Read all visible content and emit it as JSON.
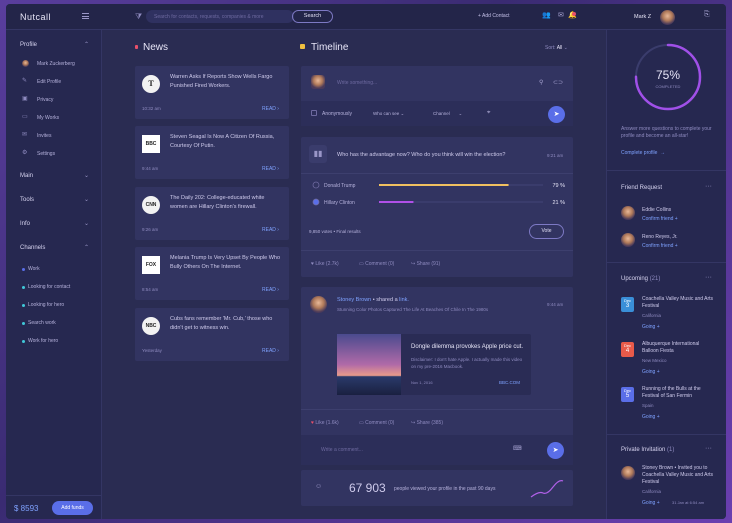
{
  "app": {
    "title": "Nutcall"
  },
  "topbar": {
    "search_placeholder": "Search for contacts, requests, companies & more",
    "search_button": "Search",
    "add_contact": "+ Add Contact",
    "user_name": "Mark Z"
  },
  "sidebar": {
    "profile_label": "Profile",
    "profile_items": [
      {
        "label": "Mark Zuckerberg",
        "icon": "avatar"
      },
      {
        "label": "Edit Profile",
        "icon": "pencil-icon"
      },
      {
        "label": "Privacy",
        "icon": "lock-icon"
      },
      {
        "label": "My Works",
        "icon": "folder-icon"
      },
      {
        "label": "Invites",
        "icon": "mail-icon"
      },
      {
        "label": "Settings",
        "icon": "gear-icon"
      }
    ],
    "main_label": "Main",
    "tools_label": "Tools",
    "info_label": "Info",
    "channels_label": "Channels",
    "channels": [
      {
        "label": "Work",
        "color": "#5a6ee8"
      },
      {
        "label": "Looking for contact",
        "color": "#40c8d8"
      },
      {
        "label": "Looking for hero",
        "color": "#40c8d8"
      },
      {
        "label": "Search work",
        "color": "#40c8d8"
      },
      {
        "label": "Work for hero",
        "color": "#40c8d8"
      }
    ],
    "balance": "$ 8593",
    "add_funds": "Add funds"
  },
  "news": {
    "title": "News",
    "items": [
      {
        "logo": "T",
        "text": "Warren Asks If Reports Show Wells Fargo Punished Fired Workers.",
        "time": "10:32 am",
        "read": "READ"
      },
      {
        "logo": "BBC",
        "text": "Steven Seagal Is Now A Citizen Of Russia, Courtesy Of Putin.",
        "time": "9:44 am",
        "read": "READ"
      },
      {
        "logo": "CNN",
        "text": "The Daily 202: College-educated white women are Hillary Clinton's firewall.",
        "time": "9:26 am",
        "read": "READ"
      },
      {
        "logo": "FOX",
        "text": "Melania Trump Is Very Upset By People Who Bully Others On The Internet.",
        "time": "8:54 am",
        "read": "READ"
      },
      {
        "logo": "NBC",
        "text": "Cubs fans remember 'Mr. Cub,' those who didn't get to witness win.",
        "time": "Yesterday",
        "read": "READ"
      }
    ]
  },
  "timeline": {
    "title": "Timeline",
    "sort_label": "Sort:",
    "sort_value": "All",
    "compose_placeholder": "Write something...",
    "audience": "Anonymously",
    "who_can_see": "Who can see",
    "channel": "Channel"
  },
  "poll": {
    "question": "Who has the advantage now? Who do you think will win the election?",
    "time": "9:21 am",
    "votes_text": "9,850 votes • Final results",
    "vote_button": "Vote",
    "like": "Like (2.7k)",
    "comment": "Comment (0)",
    "share": "Share (91)",
    "chart_data": {
      "type": "bar",
      "categories": [
        "Donald Trump",
        "Hillary Clinton"
      ],
      "values": [
        79,
        21
      ],
      "unit": "%"
    }
  },
  "post": {
    "author": "Stoney Brown",
    "action": "• shared a",
    "link": "link.",
    "subtitle": "Stunning Color Photos Captured The Life At Beaches Of Chile In The 1980s",
    "time": "9:44 am",
    "share_title": "Dongle dilemma provokes Apple price cut.",
    "share_desc": "Disclaimer: I don't hate Apple. I actually made this video on my pre-2016 Macbook.",
    "share_date": "Nov 1, 2016",
    "share_source": "BBC.COM",
    "like": "Like (1.6k)",
    "comment": "Comment (0)",
    "share": "Share (385)",
    "comment_placeholder": "Write a comment..."
  },
  "stats": {
    "value": "67 903",
    "label": "people viewed your profile in the past 90 days"
  },
  "profile_progress": {
    "percent": "75%",
    "label": "COMPLETED",
    "fraction": 0.75,
    "text": "Answer more questions to complete your profile and become an all-star!",
    "link": "Complete profile"
  },
  "friend_request": {
    "title": "Friend Request",
    "items": [
      {
        "name": "Eddie Collins",
        "action": "Confirm friend +"
      },
      {
        "name": "Reno Reyes, Jr.",
        "action": "Confirm friend +"
      }
    ]
  },
  "upcoming": {
    "title": "Upcoming",
    "count": "(21)",
    "items": [
      {
        "month": "Dec",
        "day": "3",
        "color": "#3a8fd8",
        "title": "Coachella Valley Music and Arts Festival",
        "place": "California",
        "go": "Going +"
      },
      {
        "month": "Dec",
        "day": "4",
        "color": "#e85a4a",
        "title": "Albuquerque International Balloon Fiesta",
        "place": "New Mexico",
        "go": "Going +"
      },
      {
        "month": "Dec",
        "day": "5",
        "color": "#5a6ee8",
        "title": "Running of the Bulls at the Festival of San Fermin",
        "place": "Spain",
        "go": "Going +"
      }
    ]
  },
  "private_invitation": {
    "title": "Private Invitation",
    "count": "(1)",
    "text": "Stoney Brown • Invited you to Coachella Valley Music and Arts Festival",
    "place": "California",
    "go": "Going +",
    "time": "31 Jan at 6:54 am"
  }
}
